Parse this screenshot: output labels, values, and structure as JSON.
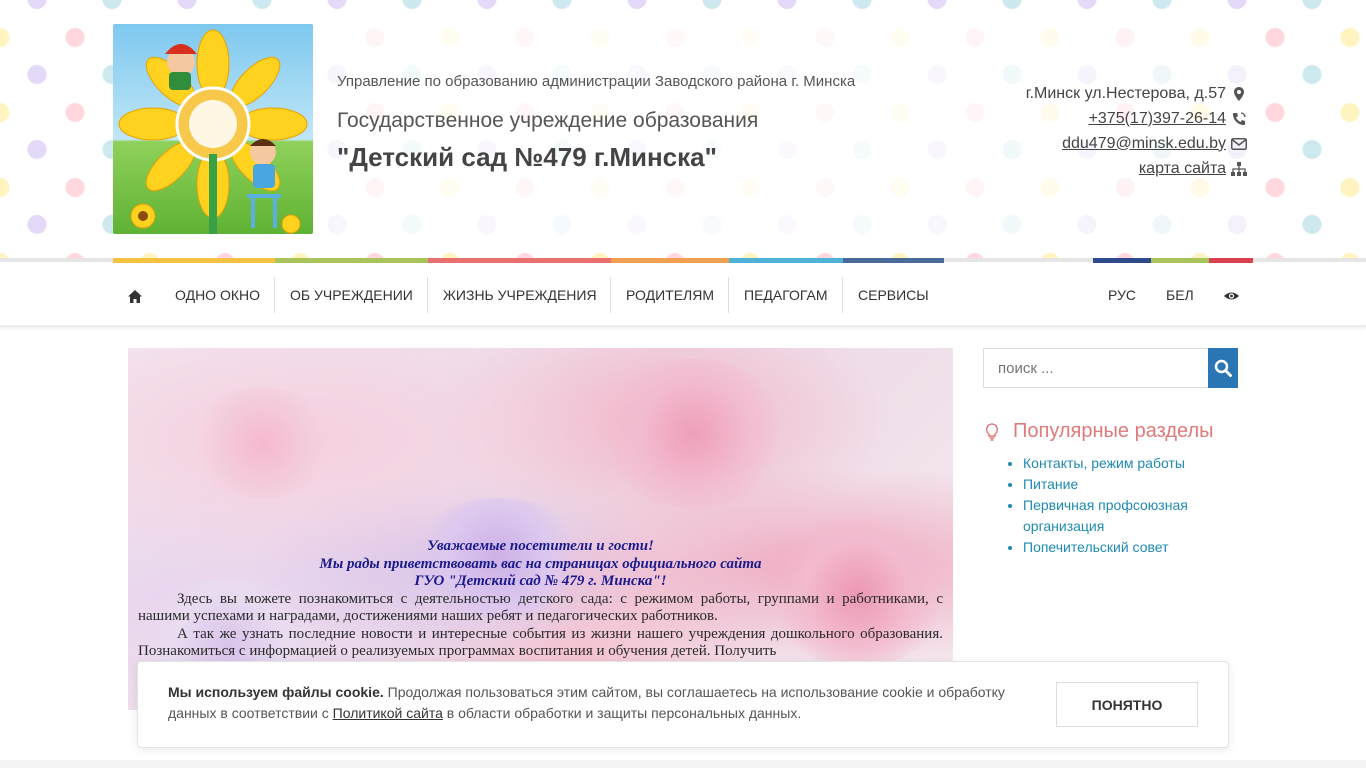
{
  "header": {
    "parent_org": "Управление по образованию администрации Заводского района г. Минска",
    "org_type": "Государственное учреждение образования",
    "org_name": "\"Детский сад №479 г.Минска\"",
    "contacts": {
      "address": "г.Минск ул.Нестерова, д.57",
      "phone": "+375(17)397-26-14",
      "email": "ddu479@minsk.edu.by",
      "sitemap": "карта сайта"
    }
  },
  "stripe_colors": [
    "#f5c242",
    "#a8c45a",
    "#e8706e",
    "#f0a050",
    "#4fb3d8",
    "#4a6a9a",
    "#2e4a8a",
    "#a8c45a",
    "#d94050"
  ],
  "nav": {
    "items": [
      {
        "label": "ОДНО ОКНО"
      },
      {
        "label": "ОБ УЧРЕЖДЕНИИ"
      },
      {
        "label": "ЖИЗНЬ УЧРЕЖДЕНИЯ"
      },
      {
        "label": "РОДИТЕЛЯМ"
      },
      {
        "label": "ПЕДАГОГАМ"
      },
      {
        "label": "СЕРВИСЫ"
      }
    ],
    "lang_ru": "РУС",
    "lang_by": "БЕЛ"
  },
  "slide": {
    "greet_line1": "Уважаемые посетители и гости!",
    "greet_line2": "Мы рады приветствовать вас на страницах официального сайта",
    "greet_line3": "ГУО \"Детский сад № 479 г. Минска\"!",
    "para1": "Здесь вы можете познакомиться с деятельностью детского сада: с режимом работы, группами и работниками, с нашими успехами и наградами, достижениями наших ребят и педагогических работников.",
    "para2": "А так же узнать последние новости и интересные события из жизни нашего учреждения дошкольного образования. Познакомиться с информацией о реализуемых программах воспитания и обучения детей. Получить"
  },
  "sidebar": {
    "search_placeholder": "поиск ...",
    "popular_title": "Популярные разделы",
    "popular_items": [
      {
        "label": "Контакты, режим работы"
      },
      {
        "label": "Питание"
      },
      {
        "label": "Первичная профсоюзная организация"
      },
      {
        "label": "Попечительский совет"
      }
    ]
  },
  "cookie": {
    "bold": "Мы используем файлы cookie.",
    "text1": " Продолжая пользоваться этим сайтом, вы соглашаетесь на использование cookie и обработку данных в соответствии с ",
    "link": "Политикой сайта",
    "text2": " в области обработки и защиты персональных данных.",
    "button": "ПОНЯТНО"
  }
}
